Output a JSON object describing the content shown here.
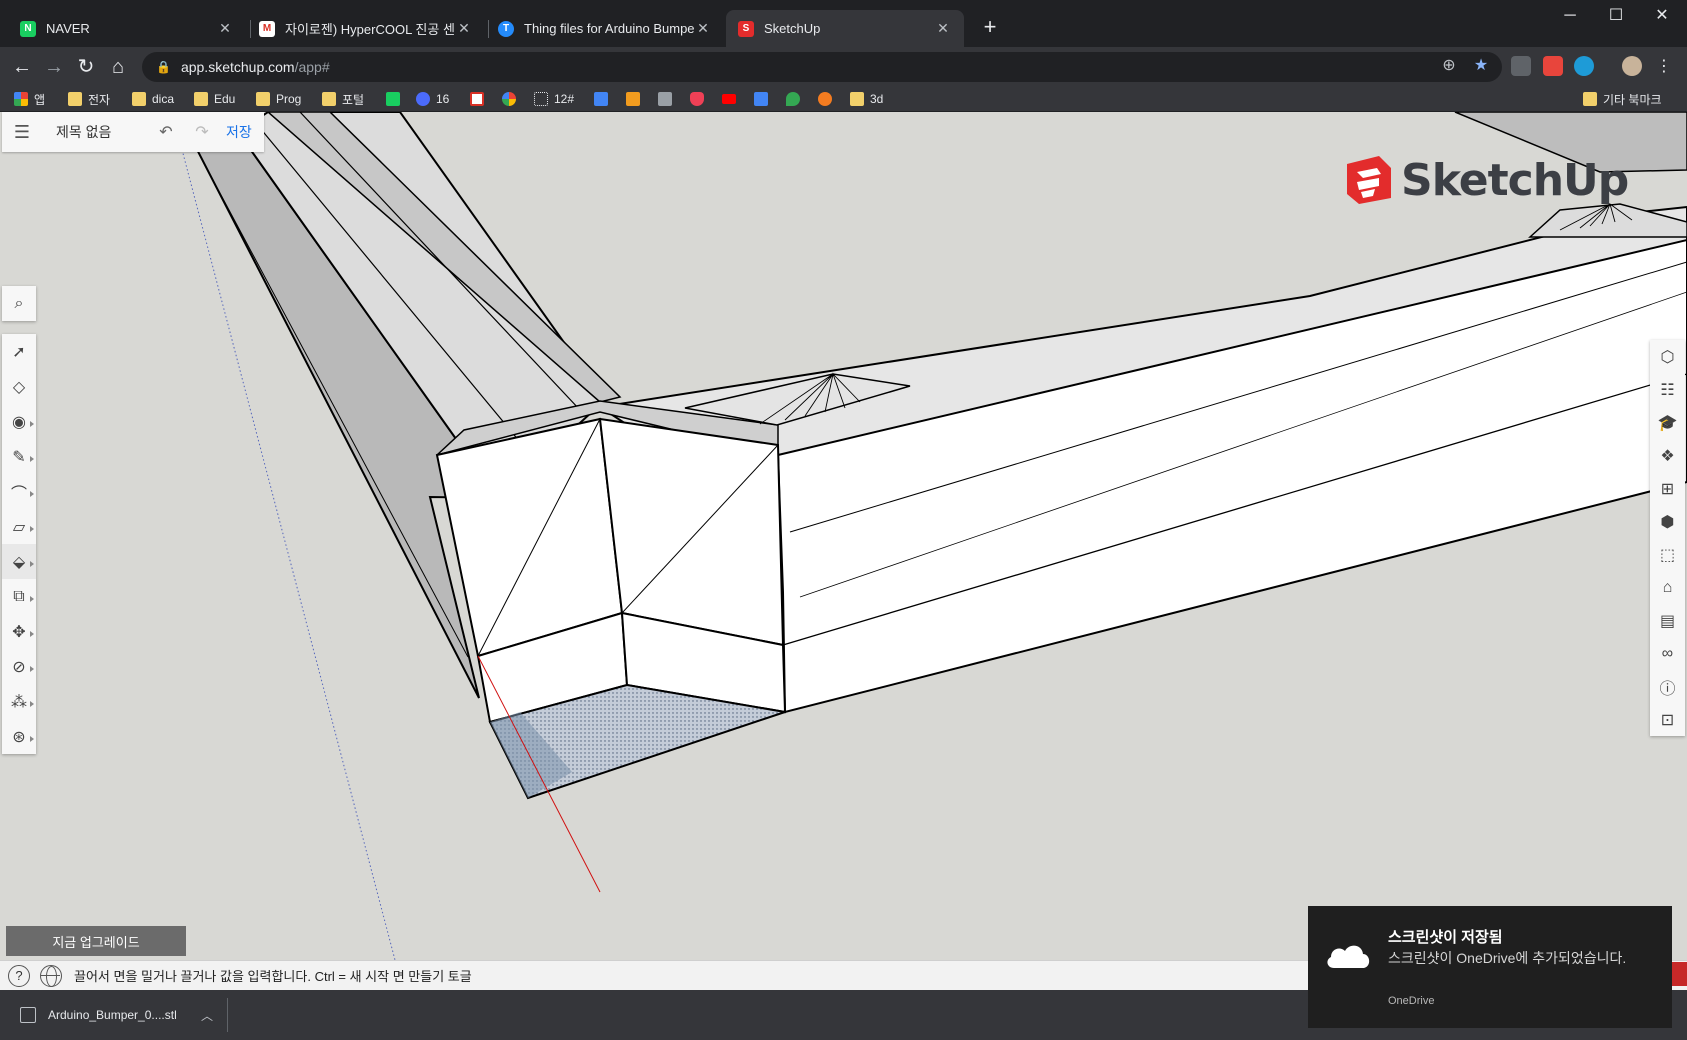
{
  "browser": {
    "tabs": [
      {
        "title": "NAVER",
        "favicon_color": "#19ce60",
        "favicon_glyph": "N"
      },
      {
        "title": "자이로젠) HyperCOOL 진공 센서",
        "favicon_color": "#ffffff",
        "favicon_glyph": "M"
      },
      {
        "title": "Thing files for Arduino Bumper",
        "favicon_color": "#248bfb",
        "favicon_glyph": "T"
      },
      {
        "title": "SketchUp",
        "favicon_color": "#e32c2c",
        "favicon_glyph": "S"
      }
    ],
    "active_tab_index": 3,
    "new_tab_glyph": "+",
    "url_host": "app.sketchup.com",
    "url_path": "/app#",
    "bookmarks": [
      {
        "label": "앱",
        "kind": "apps"
      },
      {
        "label": "전자",
        "kind": "folder"
      },
      {
        "label": "dica",
        "kind": "folder"
      },
      {
        "label": "Edu",
        "kind": "folder"
      },
      {
        "label": "Prog",
        "kind": "folder"
      },
      {
        "label": "포털",
        "kind": "folder"
      },
      {
        "label": "",
        "kind": "naver"
      },
      {
        "label": "16",
        "kind": "site"
      },
      {
        "label": "",
        "kind": "gmail"
      },
      {
        "label": "",
        "kind": "photos"
      },
      {
        "label": "12#",
        "kind": "site"
      },
      {
        "label": "",
        "kind": "calendar"
      },
      {
        "label": "",
        "kind": "r"
      },
      {
        "label": "",
        "kind": "print"
      },
      {
        "label": "",
        "kind": "pocket"
      },
      {
        "label": "",
        "kind": "youtube"
      },
      {
        "label": "",
        "kind": "translate"
      },
      {
        "label": "",
        "kind": "maps"
      },
      {
        "label": "",
        "kind": "orange"
      },
      {
        "label": "3d",
        "kind": "folder"
      }
    ],
    "other_bookmarks": "기타 북마크"
  },
  "sketchup": {
    "document_title": "제목 없음",
    "save_label": "저장",
    "logo_text": "SketchUp",
    "upgrade_label": "지금 업그레이드",
    "status_message": "끌어서 면을 밀거나 끌거나 값을 입력합니다. Ctrl = 새 시작 면 만들기 토글",
    "left_tools": [
      "search",
      "select",
      "eraser",
      "paint",
      "pencil",
      "arc",
      "rectangle",
      "push-pull",
      "offset",
      "move",
      "tape-measure",
      "walk",
      "orbit"
    ],
    "right_tools": [
      "styles",
      "outliner",
      "instructor",
      "scenes",
      "components",
      "entity-info",
      "views",
      "tags",
      "animation",
      "display",
      "model-info",
      "3d-warehouse"
    ]
  },
  "downloads": {
    "file_name": "Arduino_Bumper_0....stl"
  },
  "toast": {
    "title": "스크린샷이 저장됨",
    "body": "스크린샷이 OneDrive에 추가되었습니다.",
    "source": "OneDrive"
  },
  "colors": {
    "chrome_dark": "#202124",
    "chrome_toolbar": "#35363a",
    "sketchup_red": "#e32c2c",
    "save_blue": "#1a73e8",
    "viewport_bg": "#d8d8d4"
  }
}
